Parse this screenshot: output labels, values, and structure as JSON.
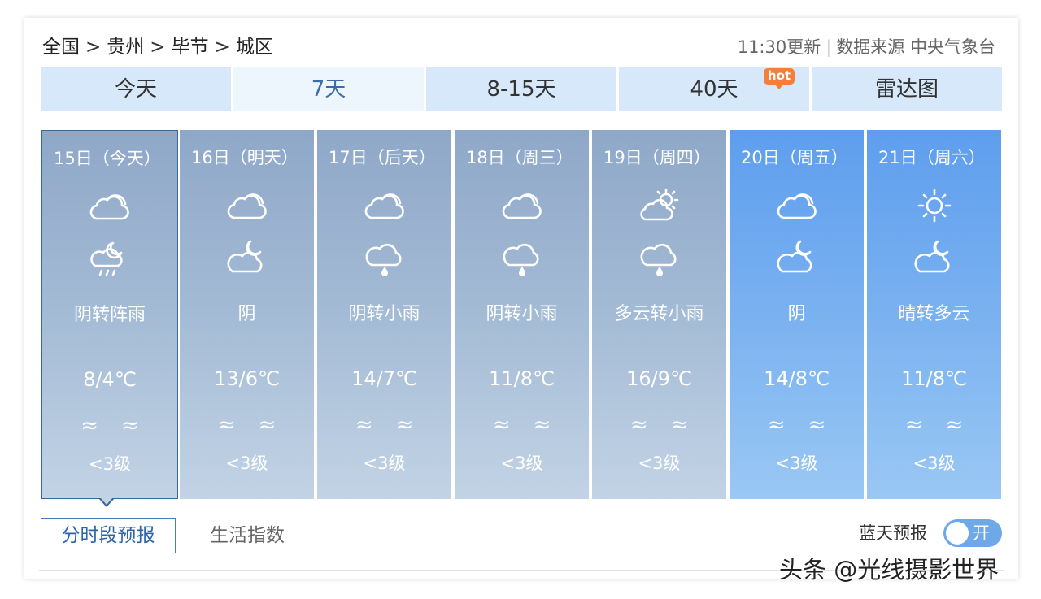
{
  "breadcrumb": {
    "items": [
      "全国",
      "贵州",
      "毕节",
      "城区"
    ],
    "separator": ">"
  },
  "meta": {
    "updated": "11:30更新",
    "source": "数据来源 中央气象台"
  },
  "tabs": [
    {
      "label": "今天"
    },
    {
      "label": "7天"
    },
    {
      "label": "8-15天"
    },
    {
      "label": "40天",
      "badge": "hot"
    },
    {
      "label": "雷达图"
    }
  ],
  "days": [
    {
      "date": "15日（今天）",
      "icon1": "cloud-icon",
      "icon2": "night-shower-icon",
      "desc": "阴转阵雨",
      "temp": "8/4℃",
      "wave": "≈≈",
      "wind": "<3级"
    },
    {
      "date": "16日（明天）",
      "icon1": "cloud-icon",
      "icon2": "night-cloud-icon",
      "desc": "阴",
      "temp": "13/6℃",
      "wave": "≈≈",
      "wind": "<3级"
    },
    {
      "date": "17日（后天）",
      "icon1": "cloud-icon",
      "icon2": "light-rain-icon",
      "desc": "阴转小雨",
      "temp": "14/7℃",
      "wave": "≈≈",
      "wind": "<3级"
    },
    {
      "date": "18日（周三）",
      "icon1": "cloud-icon",
      "icon2": "light-rain-icon",
      "desc": "阴转小雨",
      "temp": "11/8℃",
      "wave": "≈≈",
      "wind": "<3级"
    },
    {
      "date": "19日（周四）",
      "icon1": "partly-cloudy-icon",
      "icon2": "light-rain-icon",
      "desc": "多云转小雨",
      "temp": "16/9℃",
      "wave": "≈≈",
      "wind": "<3级"
    },
    {
      "date": "20日（周五）",
      "icon1": "cloud-icon",
      "icon2": "night-cloud-icon",
      "desc": "阴",
      "temp": "14/8℃",
      "wave": "≈≈",
      "wind": "<3级"
    },
    {
      "date": "21日（周六）",
      "icon1": "sun-icon",
      "icon2": "night-cloud-icon",
      "desc": "晴转多云",
      "temp": "11/8℃",
      "wave": "≈≈",
      "wind": "<3级"
    }
  ],
  "subtabs": {
    "active": "分时段预报",
    "other": "生活指数"
  },
  "bluesky": {
    "label": "蓝天预报",
    "toggle": "开"
  },
  "watermark": "头条 @光线摄影世界",
  "colors": {
    "tab_bg": "#d6e8f9",
    "tab_active_bg": "#eef6fd",
    "day_gray_top": "#8fa8c8",
    "day_blue_top": "#5e9eee",
    "hot_badge": "#f47e3c",
    "accent": "#2d66a8"
  }
}
